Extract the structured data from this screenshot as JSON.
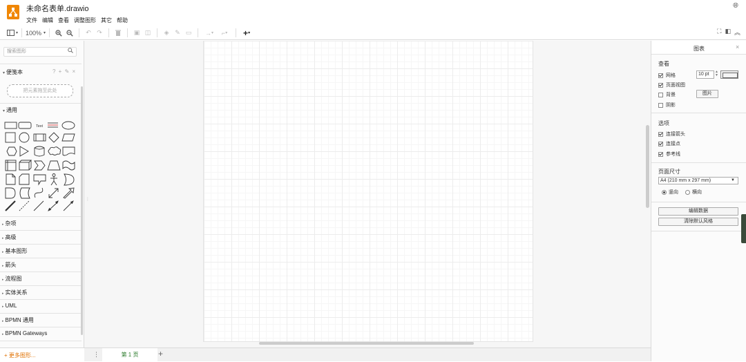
{
  "app": {
    "file_title": "未命名表单.drawio",
    "menu": [
      "文件",
      "编辑",
      "查看",
      "调整图形",
      "其它",
      "帮助"
    ]
  },
  "toolbar": {
    "zoom": "100%"
  },
  "sidebar": {
    "search_placeholder": "搜索图形",
    "scratchpad_title": "便笺本",
    "scratchpad_actions": "? + ✎ ×",
    "drop_hint": "把元素拖至此处",
    "general_title": "通用",
    "text_shape_label": "Text",
    "categories": [
      "杂项",
      "高级",
      "基本图形",
      "箭头",
      "流程图",
      "实体关系",
      "UML",
      "BPMN 通用",
      "BPMN Gateways"
    ],
    "more_shapes": "+ 更多图形..."
  },
  "tabs": {
    "page1": "第 1 页"
  },
  "format_panel": {
    "title": "图表",
    "view_heading": "查看",
    "grid_label": "网格",
    "grid_size": "10 pt",
    "page_view_label": "页面视图",
    "background_label": "背景",
    "image_button": "图片",
    "shadow_label": "阴影",
    "options_heading": "选项",
    "connection_arrows": "连接箭头",
    "connection_points": "连接点",
    "guides": "参考线",
    "paper_size_heading": "页面尺寸",
    "paper_size": "A4 (210 mm x 297 mm)",
    "portrait": "竖向",
    "landscape": "横向",
    "edit_data_button": "编辑数据",
    "clear_style_button": "清除默认风格"
  },
  "colors": {
    "brand": "#f08705",
    "page_tab_text": "#2a7a2a",
    "more_shapes_text": "#e07000"
  }
}
